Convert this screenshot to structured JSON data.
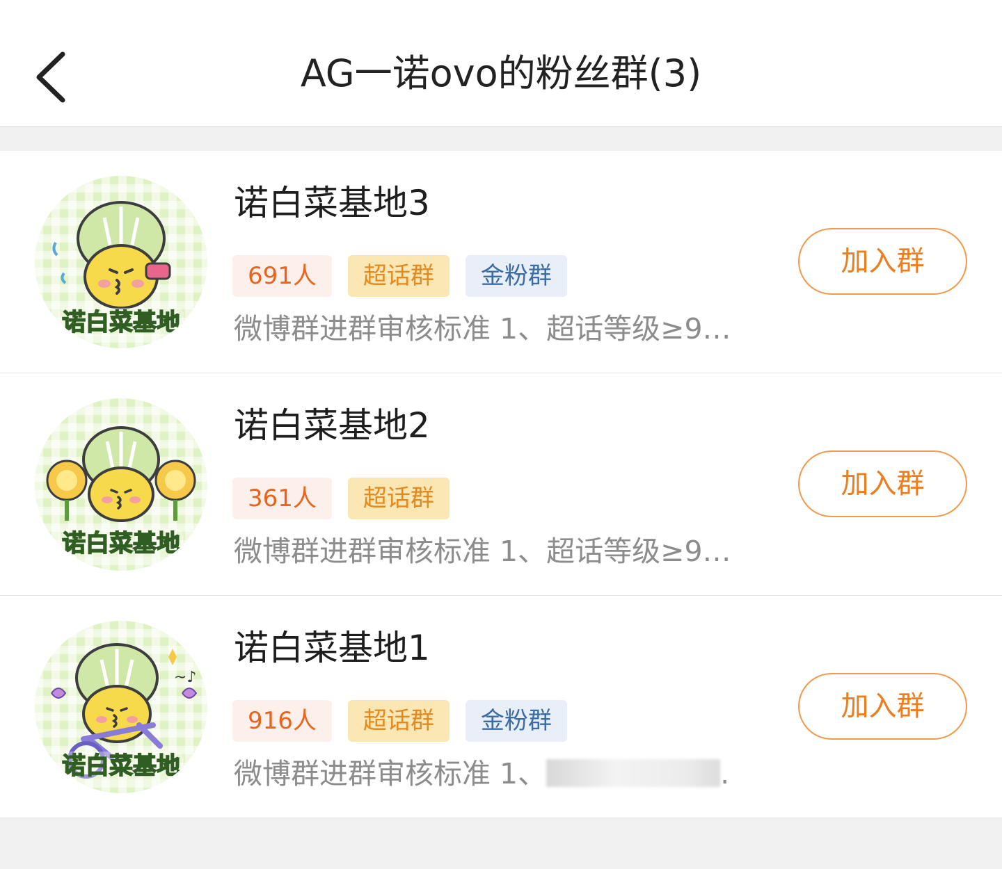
{
  "header": {
    "title": "AG一诺ovo的粉丝群(3)",
    "back_icon": "chevron-left-icon"
  },
  "groups": [
    {
      "name": "诺白菜基地3",
      "avatar_text": "诺白菜基地",
      "members_tag": "691人",
      "super_tag": "超话群",
      "gold_tag": "金粉群",
      "desc": "微博群进群审核标准 1、超话等级≥9…",
      "join_label": "加入群"
    },
    {
      "name": "诺白菜基地2",
      "avatar_text": "诺白菜基地",
      "members_tag": "361人",
      "super_tag": "超话群",
      "desc": "微博群进群审核标准 1、超话等级≥9…",
      "join_label": "加入群"
    },
    {
      "name": "诺白菜基地1",
      "avatar_text": "诺白菜基地",
      "members_tag": "916人",
      "super_tag": "超话群",
      "gold_tag": "金粉群",
      "desc": "微博群进群审核标准 1、",
      "desc_tail": ".",
      "join_label": "加入群"
    }
  ],
  "colors": {
    "accent": "#ed7e20",
    "members_tag_bg": "#fdefea",
    "super_tag_bg": "#fbe7b4",
    "gold_tag_bg": "#e9eff8",
    "gold_tag_text": "#3a6ba6"
  }
}
